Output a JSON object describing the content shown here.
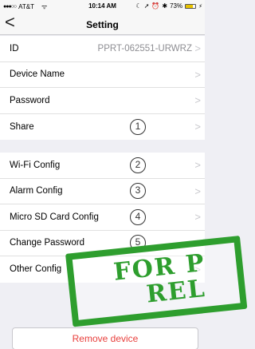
{
  "status_bar": {
    "signal": "●●●○○",
    "carrier": "AT&T",
    "wifi_icon": "wifi-icon",
    "time": "10:14 AM",
    "battery_percent": "73%",
    "battery_level": 0.73
  },
  "nav": {
    "back_glyph": "<",
    "title": "Setting"
  },
  "group1": [
    {
      "label": "ID",
      "value": "PPRT-062551-URWRZ",
      "chevron": ">"
    },
    {
      "label": "Device Name",
      "value": "",
      "chevron": ">"
    },
    {
      "label": "Password",
      "value": "",
      "chevron": ">"
    },
    {
      "label": "Share",
      "value": "",
      "chevron": ">",
      "marker": "1"
    }
  ],
  "group2": [
    {
      "label": "Wi-Fi Config",
      "chevron": ">",
      "marker": "2"
    },
    {
      "label": "Alarm Config",
      "chevron": ">",
      "marker": "3"
    },
    {
      "label": "Micro SD Card Config",
      "chevron": ">",
      "marker": "4"
    },
    {
      "label": "Change Password",
      "chevron": ">",
      "marker": "5"
    },
    {
      "label": "Other Config",
      "chevron": ">"
    }
  ],
  "remove_button": "Remove device",
  "stamp": {
    "line1": "FOR P",
    "line2": "REL",
    "color": "#2e9e2e"
  },
  "colors": {
    "destructive": "#e8403d",
    "secondary_text": "#8e8e93",
    "background": "#efeff4"
  }
}
